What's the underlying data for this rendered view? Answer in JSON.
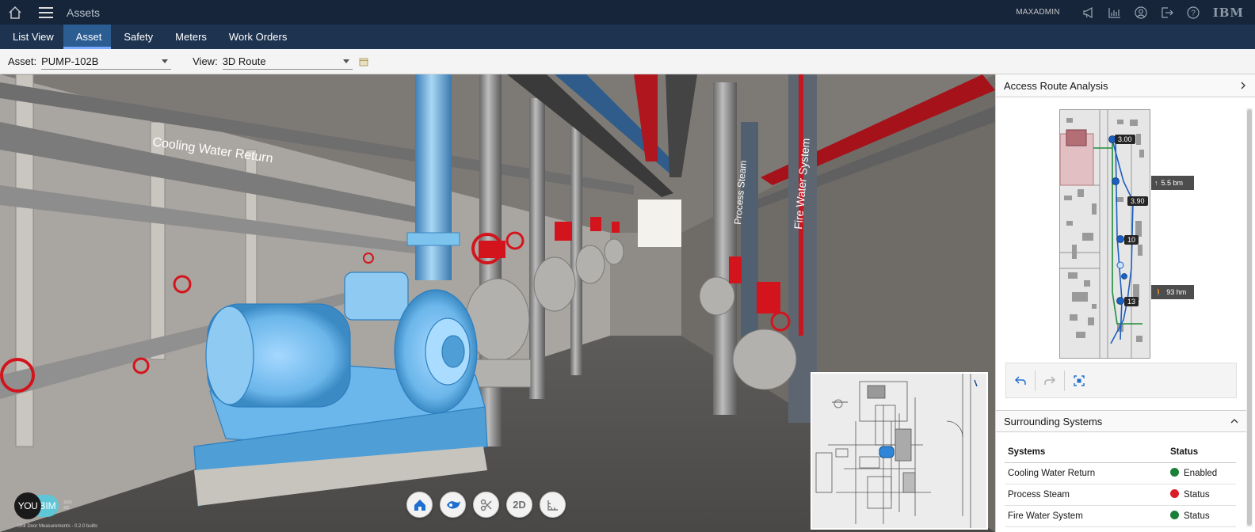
{
  "topbar": {
    "title": "Assets",
    "user": "MAXADMIN",
    "brand": "IBM",
    "icons": [
      "home-icon",
      "menu-icon",
      "megaphone-icon",
      "chart-icon",
      "user-icon",
      "logout-icon",
      "help-icon"
    ]
  },
  "tabs": [
    {
      "label": "List View",
      "active": false
    },
    {
      "label": "Asset",
      "active": true
    },
    {
      "label": "Safety",
      "active": false
    },
    {
      "label": "Meters",
      "active": false
    },
    {
      "label": "Work Orders",
      "active": false
    }
  ],
  "filters": {
    "asset_label": "Asset:",
    "asset_value": "PUMP-102B",
    "view_label": "View:",
    "view_value": "3D Route"
  },
  "scene": {
    "pipe_label_1": "Cooling Water Return",
    "pipe_label_2": "Process Steam",
    "pipe_label_3": "Fire Water System"
  },
  "viewer_tools": [
    "home-view-icon",
    "fly-icon",
    "section-icon",
    "2D",
    "measure-icon"
  ],
  "brand_logo": {
    "you": "YOU",
    "bim": "BIM",
    "caption": "Unit Door Measurements - 0.2.0 builts"
  },
  "route_panel": {
    "title": "Access Route Analysis",
    "tags": {
      "t1": "3.00",
      "t2": "3.90",
      "t3": "10",
      "t4": "13",
      "dist1": "5.5 bm",
      "dist2": "93 hm"
    }
  },
  "surrounding": {
    "title": "Surrounding Systems",
    "headers": {
      "systems": "Systems",
      "status": "Status"
    },
    "rows": [
      {
        "name": "Cooling Water Return",
        "status": "Enabled",
        "color": "#198038"
      },
      {
        "name": "Process Steam",
        "status": "Status",
        "color": "#da1e28"
      },
      {
        "name": "Fire Water System",
        "status": "Status",
        "color": "#198038"
      }
    ]
  },
  "colors": {
    "topbar": "#16253a",
    "tabsbar": "#1d3350",
    "active_tab": "#2b5d93",
    "highlight": "#5fb7ff",
    "valve": "#d4141c"
  }
}
